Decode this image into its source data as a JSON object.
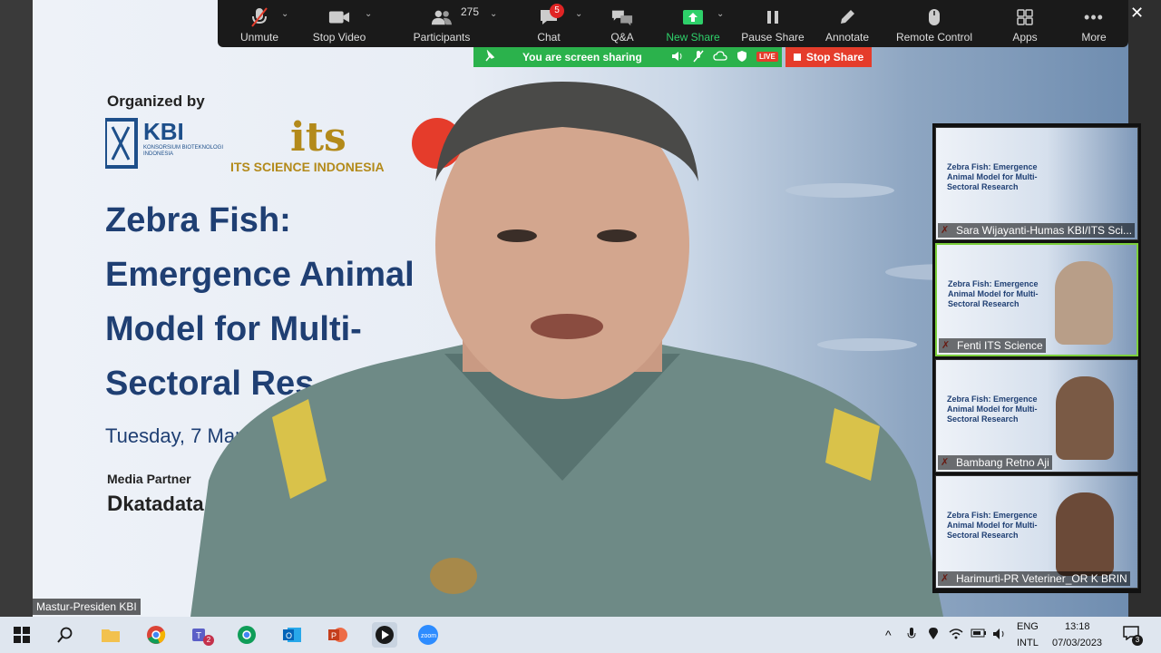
{
  "toolbar": {
    "unmute": "Unmute",
    "stop_video": "Stop Video",
    "participants": "Participants",
    "participant_count": "275",
    "chat": "Chat",
    "chat_badge": "5",
    "qa": "Q&A",
    "new_share": "New Share",
    "pause_share": "Pause Share",
    "annotate": "Annotate",
    "remote_control": "Remote Control",
    "apps": "Apps",
    "more": "More"
  },
  "share_bar": {
    "status": "You are screen sharing",
    "live": "LIVE",
    "stop_share": "Stop Share"
  },
  "slide": {
    "organized_by": "Organized by",
    "kbi": "KBI",
    "kbi_sub": "KONSORSIUM BIOTEKNOLOGI INDONESIA",
    "its_logo": "its",
    "its_name": "ITS SCIENCE INDONESIA",
    "title_line1": "Zebra Fish:",
    "title_line2": "Emergence Animal",
    "title_line3": "Model for Multi-",
    "title_line4": "Sectoral Res",
    "date": "Tuesday, 7 March",
    "media_partner": "Media Partner",
    "katadata": "katadata"
  },
  "speaker": {
    "name": "Mastur-Presiden KBI"
  },
  "thumbnails": [
    {
      "name": "Sara Wijayanti-Humas KBI/ITS Sci..."
    },
    {
      "name": "Fenti ITS Science"
    },
    {
      "name": "Bambang Retno Aji"
    },
    {
      "name": "Harimurti-PR Veteriner_OR K BRIN"
    }
  ],
  "thumb_slide_title": "Zebra Fish: Emergence Animal Model for Multi-Sectoral Research",
  "taskbar": {
    "lang_top": "ENG",
    "lang_bottom": "INTL",
    "time": "13:18",
    "date": "07/03/2023",
    "notification_count": "3",
    "teams_badge": "2"
  },
  "colors": {
    "toolbar_bg": "#1a1a1a",
    "share_green": "#2bb24c",
    "stop_red": "#e53c2b",
    "slide_title_blue": "#1f3f73"
  }
}
